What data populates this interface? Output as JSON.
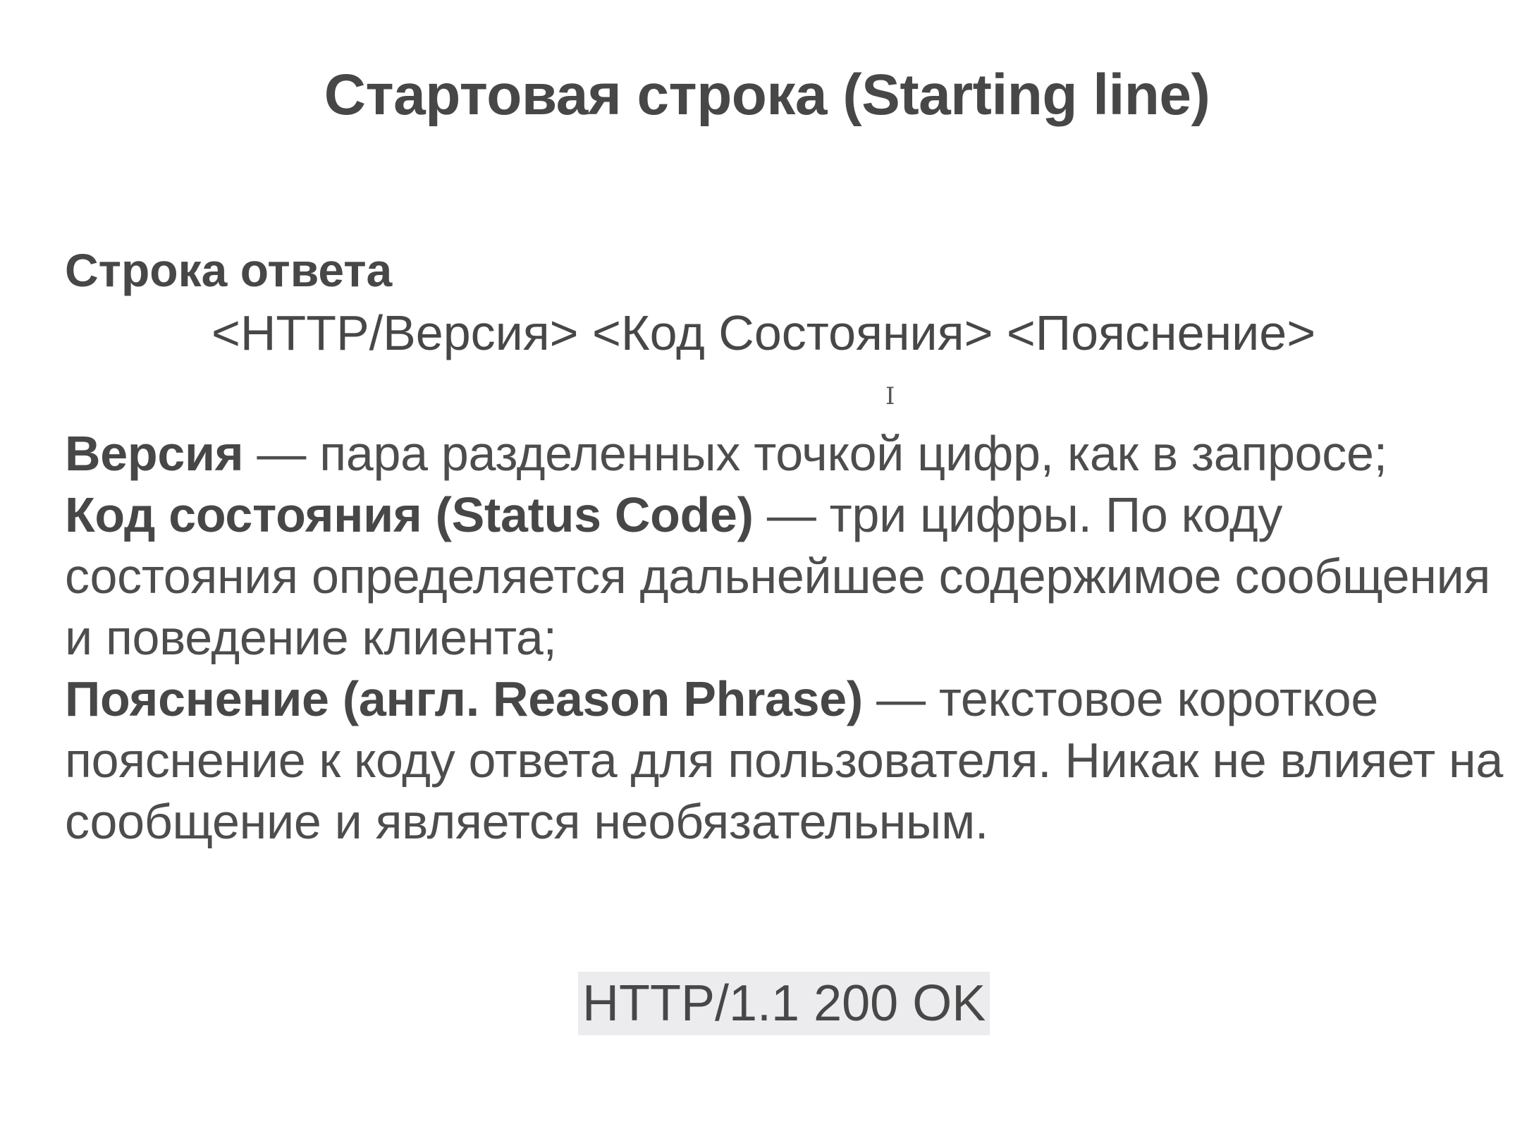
{
  "slide": {
    "title": "Стартовая строка (Starting line)",
    "subheading": "Строка ответа",
    "format_line": "<HTTP/Версия> <Код Состояния> <Пояснение>",
    "cursor_glyph": "I",
    "definitions": [
      {
        "term": "Версия",
        "text": " — пара разделенных точкой цифр, как в запросе;"
      },
      {
        "term": "Код состояния (Status Code)",
        "text": " — три цифры. По коду состояния определяется дальнейшее содержимое сообщения и поведение клиента;"
      },
      {
        "term": "Пояснение (англ. Reason Phrase)",
        "text": " — текстовое короткое пояснение к коду ответа для пользователя. Никак не влияет на сообщение и является необязательным."
      }
    ],
    "example": "HTTP/1.1 200 OK"
  },
  "colors": {
    "text": "#4a4a4a",
    "example_highlight": "#ececee",
    "background": "#ffffff"
  }
}
